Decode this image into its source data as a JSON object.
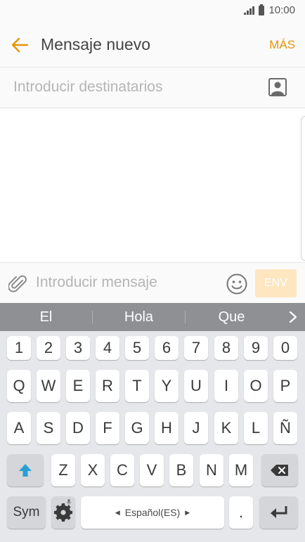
{
  "status_bar": {
    "time": "10:00"
  },
  "app_bar": {
    "title": "Mensaje nuevo",
    "more_label": "MÁS"
  },
  "recipients": {
    "placeholder": "Introducir destinatarios"
  },
  "composer": {
    "placeholder": "Introducir mensaje",
    "send_label": "ENV"
  },
  "suggestions": [
    "El",
    "Hola",
    "Que"
  ],
  "keyboard": {
    "number_row": [
      "1",
      "2",
      "3",
      "4",
      "5",
      "6",
      "7",
      "8",
      "9",
      "0"
    ],
    "row1": [
      "Q",
      "W",
      "E",
      "R",
      "T",
      "Y",
      "U",
      "I",
      "O",
      "P"
    ],
    "row2": [
      "A",
      "S",
      "D",
      "F",
      "G",
      "H",
      "J",
      "K",
      "L",
      "Ñ"
    ],
    "row3": [
      "Z",
      "X",
      "C",
      "V",
      "B",
      "N",
      "M"
    ],
    "sym_label": "Sym",
    "space_label": "Español(ES)",
    "period_label": "."
  },
  "colors": {
    "accent": "#e8940a",
    "send_disabled": "#fde6c0",
    "suggestion_bar": "#8e9093",
    "shift_arrow": "#2a9fd6"
  },
  "icons": [
    "signal-icon",
    "battery-icon",
    "back-arrow-icon",
    "contact-icon",
    "attach-icon",
    "emoji-icon",
    "chevron-right-icon",
    "shift-icon",
    "settings-icon",
    "backspace-icon",
    "enter-icon",
    "mic-icon"
  ]
}
